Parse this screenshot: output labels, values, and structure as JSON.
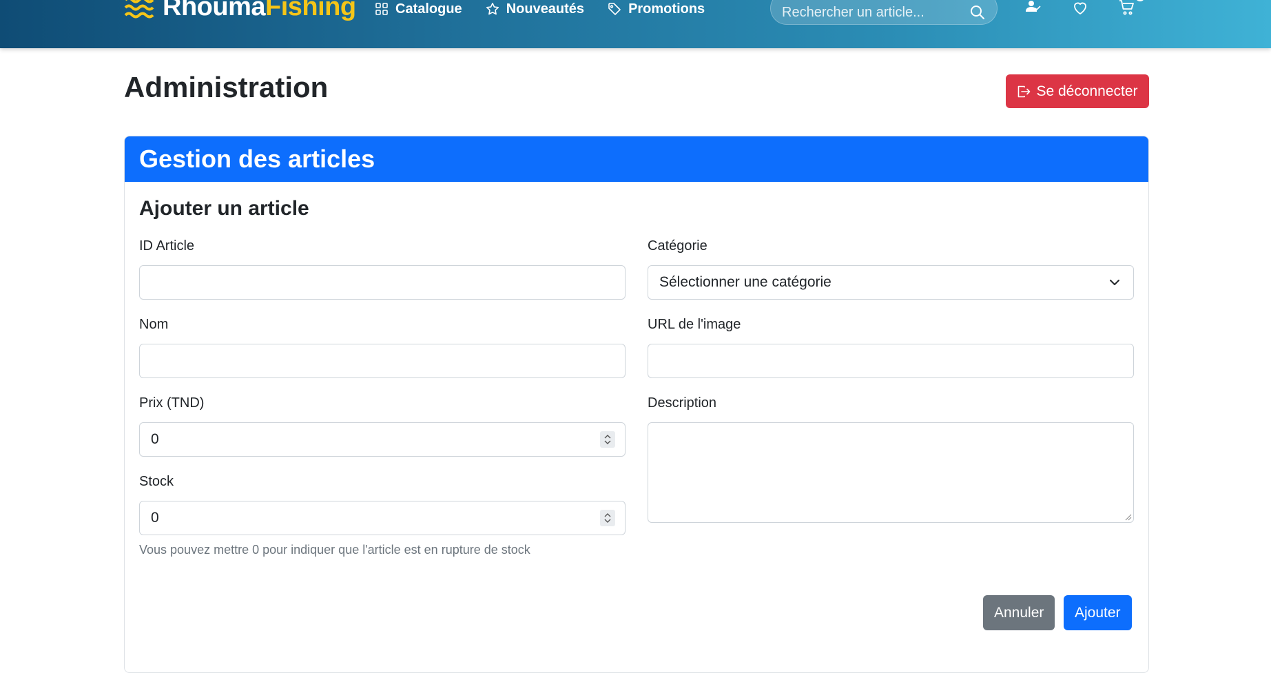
{
  "brand": {
    "part1": "Rhouma",
    "part2": "Fishing",
    "accent": "#f5c518"
  },
  "nav": {
    "links": [
      {
        "label": "Catalogue",
        "icon": "grid-icon"
      },
      {
        "label": "Nouveautés",
        "icon": "star-icon"
      },
      {
        "label": "Promotions",
        "icon": "tag-icon"
      }
    ],
    "search_placeholder": "Rechercher un article...",
    "icons": [
      "user-check-icon",
      "heart-icon",
      "cart-icon"
    ]
  },
  "page": {
    "title": "Administration",
    "logout_label": "Se déconnecter"
  },
  "card": {
    "header": "Gestion des articles",
    "section_title": "Ajouter un article",
    "fields": {
      "id_label": "ID Article",
      "id_value": "",
      "name_label": "Nom",
      "name_value": "",
      "price_label": "Prix (TND)",
      "price_value": "0",
      "stock_label": "Stock",
      "stock_value": "0",
      "stock_help": "Vous pouvez mettre 0 pour indiquer que l'article est en rupture de stock",
      "category_label": "Catégorie",
      "category_selected": "Sélectionner une catégorie",
      "image_label": "URL de l'image",
      "image_value": "",
      "description_label": "Description",
      "description_value": ""
    },
    "cancel_label": "Annuler",
    "submit_label": "Ajouter"
  },
  "colors": {
    "primary": "#0d6efd",
    "danger": "#dc3545",
    "secondary": "#6c757d"
  }
}
